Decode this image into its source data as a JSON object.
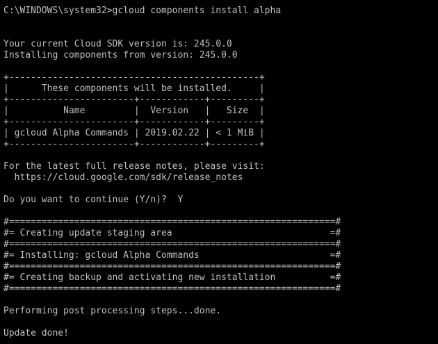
{
  "console": {
    "colors": {
      "background": "#000000",
      "text": "#c0c0c0"
    },
    "lines": [
      "C:\\WINDOWS\\system32>gcloud components install alpha",
      "",
      "",
      "Your current Cloud SDK version is: 245.0.0",
      "Installing components from version: 245.0.0",
      "",
      "+----------------------------------------------+",
      "|      These components will be installed.     |",
      "+-----------------------+------------+---------+",
      "|          Name         |  Version   |   Size  |",
      "+-----------------------+------------+---------+",
      "| gcloud Alpha Commands | 2019.02.22 | < 1 MiB |",
      "+-----------------------+------------+---------+",
      "",
      "For the latest full release notes, please visit:",
      "  https://cloud.google.com/sdk/release_notes",
      "",
      "Do you want to continue (Y/n)?  Y",
      "",
      "#============================================================#",
      "#= Creating update staging area                             =#",
      "#============================================================#",
      "#= Installing: gcloud Alpha Commands                        =#",
      "#============================================================#",
      "#= Creating backup and activating new installation          =#",
      "#============================================================#",
      "",
      "Performing post processing steps...done.",
      "",
      "Update done!"
    ]
  }
}
